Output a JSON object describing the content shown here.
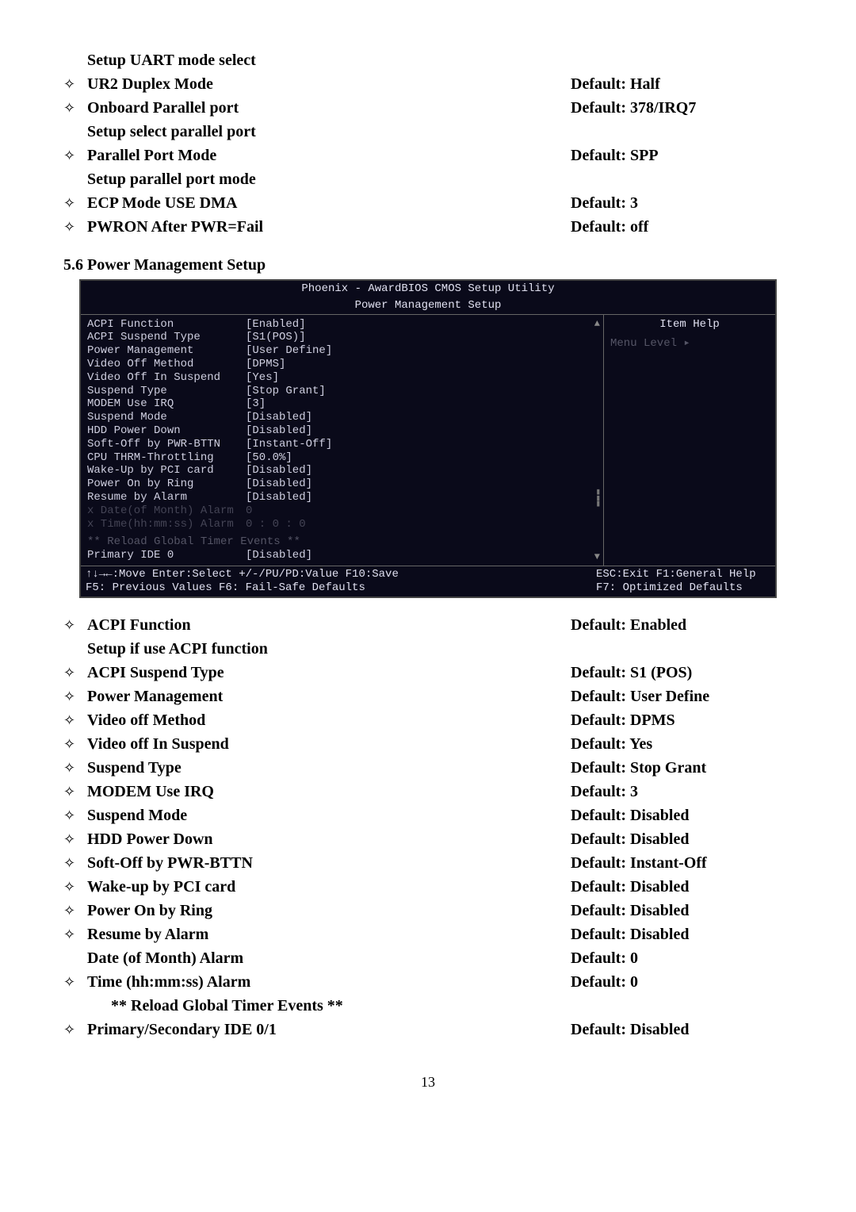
{
  "top_items": [
    {
      "diamond": "",
      "label": "Setup UART mode select",
      "default": "",
      "bold_label": true
    },
    {
      "diamond": "✧",
      "label": "UR2 Duplex Mode",
      "default": "Default: Half",
      "bold_label": true
    },
    {
      "diamond": "✧",
      "label": "Onboard Parallel port",
      "default": "Default: 378/IRQ7",
      "bold_label": true
    },
    {
      "diamond": "",
      "label": "Setup select parallel port",
      "default": "",
      "bold_label": true
    },
    {
      "diamond": "✧",
      "label": "Parallel Port Mode",
      "default": "Default: SPP",
      "bold_label": true
    },
    {
      "diamond": "",
      "label": "Setup parallel port mode",
      "default": "",
      "bold_label": true
    },
    {
      "diamond": "✧",
      "label": "ECP Mode USE DMA",
      "default": "Default: 3",
      "bold_label": true
    },
    {
      "diamond": "✧",
      "label": "PWRON After PWR=Fail",
      "default": "Default: off",
      "bold_label": true
    }
  ],
  "section_heading": "5.6 Power Management Setup",
  "bios": {
    "header1": "Phoenix - AwardBIOS CMOS Setup Utility",
    "header2": "Power Management Setup",
    "right_title": "Item Help",
    "menu_level": "Menu Level   ▸",
    "rows": [
      {
        "k": "ACPI Function",
        "v": "[Enabled]",
        "dim": false
      },
      {
        "k": "ACPI Suspend Type",
        "v": "[S1(POS)]",
        "dim": false
      },
      {
        "k": "Power Management",
        "v": "[User Define]",
        "dim": false
      },
      {
        "k": "Video Off Method",
        "v": "[DPMS]",
        "dim": false
      },
      {
        "k": "Video Off In Suspend",
        "v": "[Yes]",
        "dim": false
      },
      {
        "k": "Suspend Type",
        "v": "[Stop Grant]",
        "dim": false
      },
      {
        "k": "MODEM Use IRQ",
        "v": "[3]",
        "dim": false
      },
      {
        "k": "Suspend Mode",
        "v": "[Disabled]",
        "dim": false
      },
      {
        "k": "HDD Power Down",
        "v": "[Disabled]",
        "dim": false
      },
      {
        "k": "Soft-Off by PWR-BTTN",
        "v": "[Instant-Off]",
        "dim": false
      },
      {
        "k": "CPU THRM-Throttling",
        "v": "[50.0%]",
        "dim": false
      },
      {
        "k": "Wake-Up by PCI card",
        "v": "[Disabled]",
        "dim": false
      },
      {
        "k": "Power On by Ring",
        "v": "[Disabled]",
        "dim": false
      },
      {
        "k": "Resume by Alarm",
        "v": "[Disabled]",
        "dim": false
      },
      {
        "k": "x  Date(of Month) Alarm",
        "v": "  0",
        "dim": true
      },
      {
        "k": "x  Time(hh:mm:ss) Alarm",
        "v": "  0 :  0 :  0",
        "dim": true
      }
    ],
    "stars_header": "** Reload Global Timer Events **",
    "last_row": {
      "k": "Primary IDE 0",
      "v": "[Disabled]"
    },
    "footer_l1": "↑↓→←:Move  Enter:Select  +/-/PU/PD:Value  F10:Save",
    "footer_l2": "F5: Previous Values   F6: Fail-Safe Defaults",
    "footer_r1": "ESC:Exit  F1:General Help",
    "footer_r2": "F7: Optimized Defaults"
  },
  "bottom_items": [
    {
      "diamond": "✧",
      "label": "ACPI Function",
      "default": "Default: Enabled",
      "bold_label": true
    },
    {
      "diamond": "",
      "label": "Setup if use ACPI function",
      "default": "",
      "bold_label": true
    },
    {
      "diamond": "✧",
      "label": "ACPI Suspend Type",
      "default": "Default: S1 (POS)",
      "bold_label": true
    },
    {
      "diamond": "✧",
      "label": "Power Management",
      "default": "Default: User Define",
      "bold_label": true
    },
    {
      "diamond": "✧",
      "label": "Video off Method",
      "default": "Default: DPMS",
      "bold_label": true
    },
    {
      "diamond": "✧",
      "label": "Video off In Suspend",
      "default": "Default: Yes",
      "bold_label": true
    },
    {
      "diamond": "✧",
      "label": "Suspend Type",
      "default": "Default: Stop Grant",
      "bold_label": true
    },
    {
      "diamond": "✧",
      "label": "MODEM Use IRQ",
      "default": "Default: 3",
      "bold_label": true
    },
    {
      "diamond": "✧",
      "label": "Suspend Mode",
      "default": "Default: Disabled",
      "bold_label": true
    },
    {
      "diamond": "✧",
      "label": "HDD Power Down",
      "default": "Default: Disabled",
      "bold_label": true
    },
    {
      "diamond": "✧",
      "label": "Soft-Off by PWR-BTTN",
      "default": "Default: Instant-Off",
      "bold_label": true
    },
    {
      "diamond": "✧",
      "label": "Wake-up by PCI card",
      "default": "Default: Disabled",
      "bold_label": true
    },
    {
      "diamond": "✧",
      "label": "Power On by Ring",
      "default": "Default: Disabled",
      "bold_label": true
    },
    {
      "diamond": "✧",
      "label": "Resume by Alarm",
      "default": "Default: Disabled",
      "bold_label": true
    },
    {
      "diamond": "",
      "label": "Date (of Month) Alarm",
      "default": "Default: 0",
      "bold_label": true
    },
    {
      "diamond": "✧",
      "label": "Time (hh:mm:ss) Alarm",
      "default": "Default: 0",
      "bold_label": true
    },
    {
      "diamond": "",
      "label": "** Reload Global Timer Events **",
      "default": "",
      "bold_label": true,
      "extra_indent": true
    },
    {
      "diamond": "✧",
      "label": "Primary/Secondary IDE 0/1",
      "default": "Default: Disabled",
      "bold_label": true
    }
  ],
  "page_number": "13"
}
